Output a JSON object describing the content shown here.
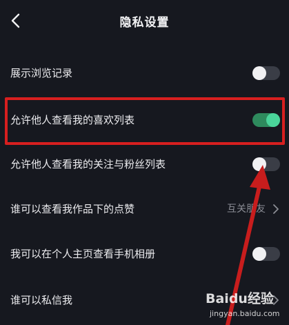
{
  "header": {
    "title": "隐私设置",
    "back_icon": "chevron-left-icon"
  },
  "settings": [
    {
      "label": "展示浏览记录",
      "control": "toggle",
      "state": "off"
    },
    {
      "label": "允许他人查看我的喜欢列表",
      "control": "toggle",
      "state": "on"
    },
    {
      "label": "允许他人查看我的关注与粉丝列表",
      "control": "toggle",
      "state": "off"
    },
    {
      "label": "谁可以查看我作品下的点赞",
      "control": "select",
      "value": "互关朋友"
    },
    {
      "label": "我可以在个人主页查看手机相册",
      "control": "toggle",
      "state": "off"
    },
    {
      "label": "谁可以私信我",
      "control": "select"
    }
  ],
  "watermark": {
    "brand": "Baidu经验",
    "url": "jingyan.baidu.com"
  },
  "colors": {
    "background": "#16181f",
    "toggle_on_track": "#2e8a5d",
    "toggle_on_knob": "#4ad49a",
    "toggle_off_track": "#3a3d46",
    "annotation_red": "#d81f1f"
  }
}
